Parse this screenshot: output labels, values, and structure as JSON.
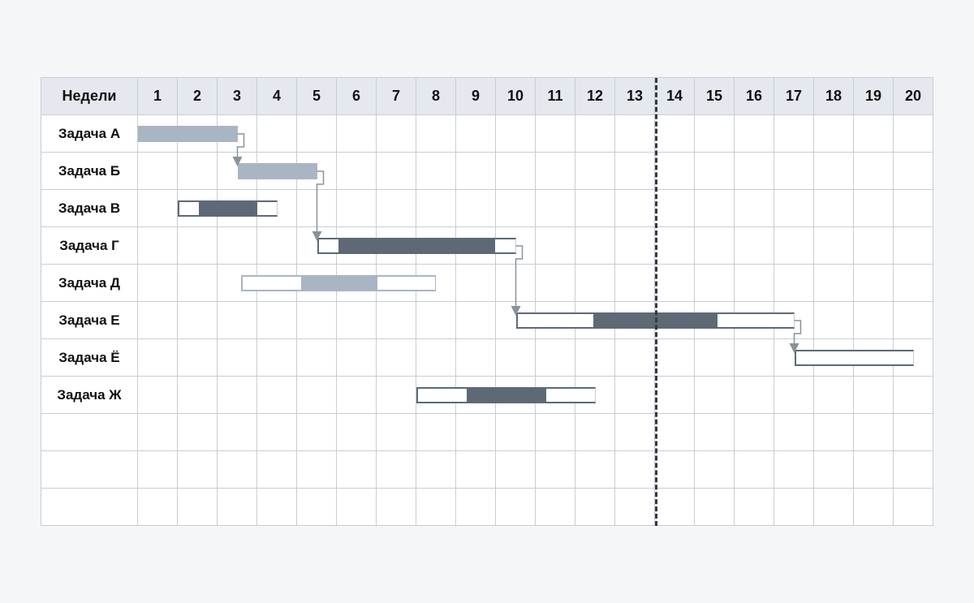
{
  "chart_data": {
    "type": "bar",
    "title": "",
    "xlabel": "Недели",
    "ylabel": "",
    "x_categories": [
      1,
      2,
      3,
      4,
      5,
      6,
      7,
      8,
      9,
      10,
      11,
      12,
      13,
      14,
      15,
      16,
      17,
      18,
      19,
      20
    ],
    "deadline_week": 13.5,
    "series": [
      {
        "name": "Задача А",
        "start": 1,
        "end": 3.5,
        "progress": 1.0,
        "critical": false
      },
      {
        "name": "Задача Б",
        "start": 3.5,
        "end": 5.5,
        "progress": 1.0,
        "critical": false
      },
      {
        "name": "Задача В",
        "start": 2,
        "end": 4.5,
        "progress": 0.6,
        "critical": true
      },
      {
        "name": "Задача Г",
        "start": 5.5,
        "end": 10.5,
        "progress": 0.8,
        "critical": true
      },
      {
        "name": "Задача Д",
        "start": 3.6,
        "end": 8.5,
        "progress": 0.4,
        "critical": false
      },
      {
        "name": "Задача Е",
        "start": 10.5,
        "end": 17.5,
        "progress": 0.45,
        "critical": true
      },
      {
        "name": "Задача Ё",
        "start": 17.5,
        "end": 20.5,
        "progress": 0.0,
        "critical": true
      },
      {
        "name": "Задача Ж",
        "start": 8,
        "end": 12.5,
        "progress": 0.45,
        "critical": true
      }
    ],
    "dependencies": [
      {
        "from": "Задача А",
        "to": "Задача Б"
      },
      {
        "from": "Задача Б",
        "to": "Задача Г"
      },
      {
        "from": "Задача Г",
        "to": "Задача Е"
      },
      {
        "from": "Задача Е",
        "to": "Задача Ё"
      }
    ],
    "extra_blank_rows": 3
  },
  "header_label": "Недели"
}
